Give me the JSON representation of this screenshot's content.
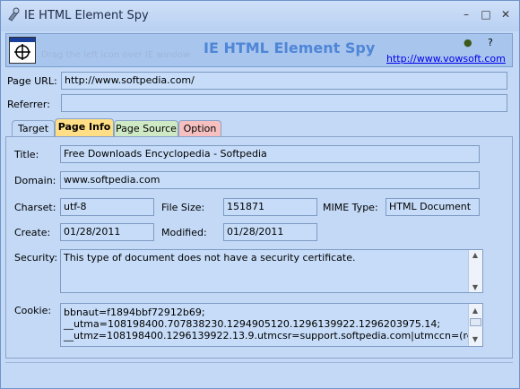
{
  "window": {
    "title": "IE HTML Element Spy",
    "minimize_label": "–",
    "maximize_label": "□",
    "close_label": "✕"
  },
  "header": {
    "hint": "Drag the left icon over IE window",
    "app_name": "IE HTML Element Spy",
    "link": "http://www.vowsoft.com",
    "help_label": "?",
    "pin_label": "●"
  },
  "fields": {
    "page_url_label": "Page URL:",
    "page_url": "http://www.softpedia.com/",
    "referrer_label": "Referrer:",
    "referrer": ""
  },
  "tabs": [
    {
      "label": "Target",
      "bg": "#c3d9f6"
    },
    {
      "label": "Page Info",
      "bg": "#ffde86"
    },
    {
      "label": "Page Source",
      "bg": "#cfe9c5"
    },
    {
      "label": "Option",
      "bg": "#f6c0c0"
    }
  ],
  "info": {
    "title_label": "Title:",
    "title": "Free Downloads Encyclopedia - Softpedia",
    "domain_label": "Domain:",
    "domain": "www.softpedia.com",
    "charset_label": "Charset:",
    "charset": "utf-8",
    "filesize_label": "File Size:",
    "filesize": "151871",
    "mime_label": "MIME Type:",
    "mime": "HTML Document",
    "create_label": "Create:",
    "create": "01/28/2011",
    "modified_label": "Modified:",
    "modified": "01/28/2011",
    "security_label": "Security:",
    "security": "This type of document does not have a security certificate.",
    "cookie_label": "Cookie:",
    "cookie_lines": [
      "bbnaut=f1894bbf72912b69;",
      "__utma=108198400.707838230.1294905120.1296139922.1296203975.14;",
      "__utmz=108198400.1296139922.13.9.utmcsr=support.softpedia.com|utmccn=(referral)"
    ]
  },
  "colors": {
    "accent": "#4f86d6",
    "tab_active": "#ffde86"
  }
}
